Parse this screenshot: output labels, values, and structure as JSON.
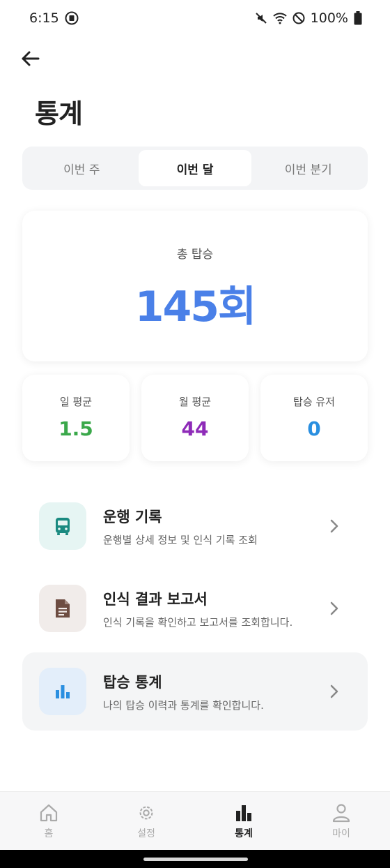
{
  "status_bar": {
    "time": "6:15",
    "battery": "100%"
  },
  "header": {
    "title": "통계"
  },
  "period_tabs": [
    {
      "label": "이번 주",
      "active": false
    },
    {
      "label": "이번 달",
      "active": true
    },
    {
      "label": "이번 분기",
      "active": false
    }
  ],
  "summary": {
    "label": "총 탑승",
    "value": "145회"
  },
  "metrics": [
    {
      "label": "일 평균",
      "value": "1.5",
      "color": "#3aa84a"
    },
    {
      "label": "월 평균",
      "value": "44",
      "color": "#8e2bb8"
    },
    {
      "label": "탑승 유저",
      "value": "0",
      "color": "#2a8fe0"
    }
  ],
  "menu": [
    {
      "title": "운행 기록",
      "subtitle": "운행별 상세 정보 및 인식 기록 조회",
      "icon": "bus-icon",
      "icon_bg": "#e6f5f3",
      "icon_color": "#1a8a80"
    },
    {
      "title": "인식 결과 보고서",
      "subtitle": "인식 기록을 확인하고 보고서를 조회합니다.",
      "icon": "document-icon",
      "icon_bg": "#f1ecea",
      "icon_color": "#6d4c41"
    },
    {
      "title": "탑승 통계",
      "subtitle": "나의 탑승 이력과 통계를 확인합니다.",
      "icon": "bar-chart-icon",
      "icon_bg": "#e3eefa",
      "icon_color": "#2a8fe0"
    }
  ],
  "bottom_nav": [
    {
      "label": "홈",
      "icon": "home-icon",
      "active": false
    },
    {
      "label": "설정",
      "icon": "gear-icon",
      "active": false
    },
    {
      "label": "통계",
      "icon": "stats-icon",
      "active": true
    },
    {
      "label": "마이",
      "icon": "person-icon",
      "active": false
    }
  ]
}
